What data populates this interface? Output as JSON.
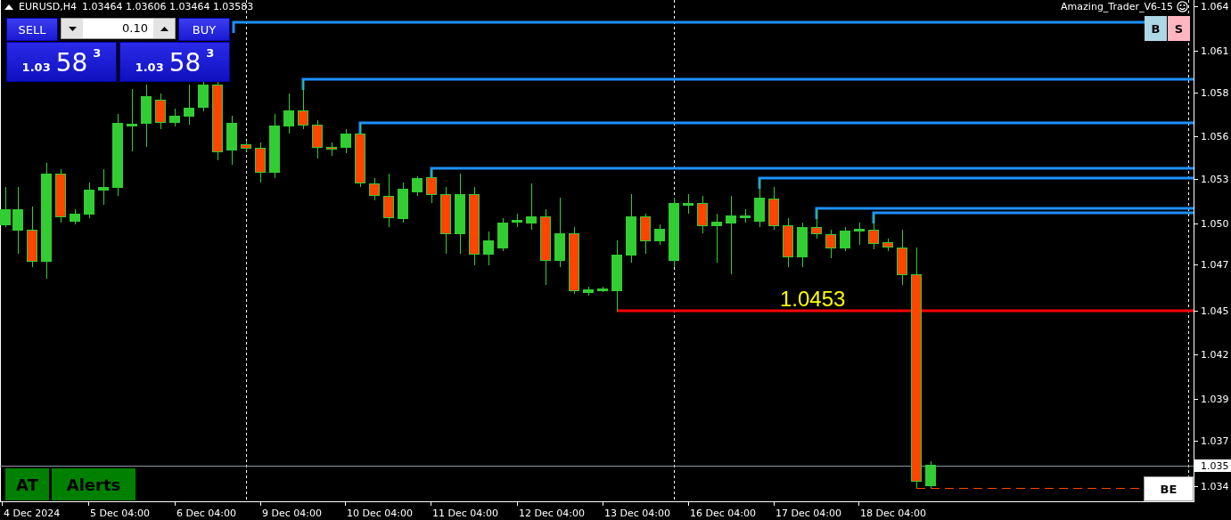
{
  "header": {
    "symbol": "EURUSD,H4",
    "quotes": "1.03464 1.03606 1.03464 1.03583"
  },
  "trade_panel": {
    "sell_label": "SELL",
    "buy_label": "BUY",
    "lot": "0.10",
    "sell_price": {
      "big_figure": "1.03",
      "pips": "58",
      "point": "3"
    },
    "buy_price": {
      "big_figure": "1.03",
      "pips": "58",
      "point": "3"
    }
  },
  "indicator": {
    "name": "Amazing_Trader_V6-15"
  },
  "side_buttons": [
    {
      "label": "B",
      "color": "#add8e6"
    },
    {
      "label": "S",
      "color": "#ffb6c1"
    }
  ],
  "bottom_buttons": [
    {
      "label": "AT"
    },
    {
      "label": "Alerts"
    }
  ],
  "be_button": {
    "label": "BE"
  },
  "level_label": "1.0453",
  "price_axis": [
    "1.064",
    "1.061",
    "1.058",
    "1.056",
    "1.053",
    "1.050",
    "1.047",
    "1.045",
    "1.042",
    "1.039",
    "1.037",
    "1.034"
  ],
  "current_price": "1.035",
  "time_axis": [
    "4 Dec 2024",
    "5 Dec 04:00",
    "6 Dec 04:00",
    "9 Dec 04:00",
    "10 Dec 04:00",
    "11 Dec 04:00",
    "12 Dec 04:00",
    "13 Dec 04:00",
    "16 Dec 04:00",
    "17 Dec 04:00",
    "18 Dec 04:00"
  ]
}
